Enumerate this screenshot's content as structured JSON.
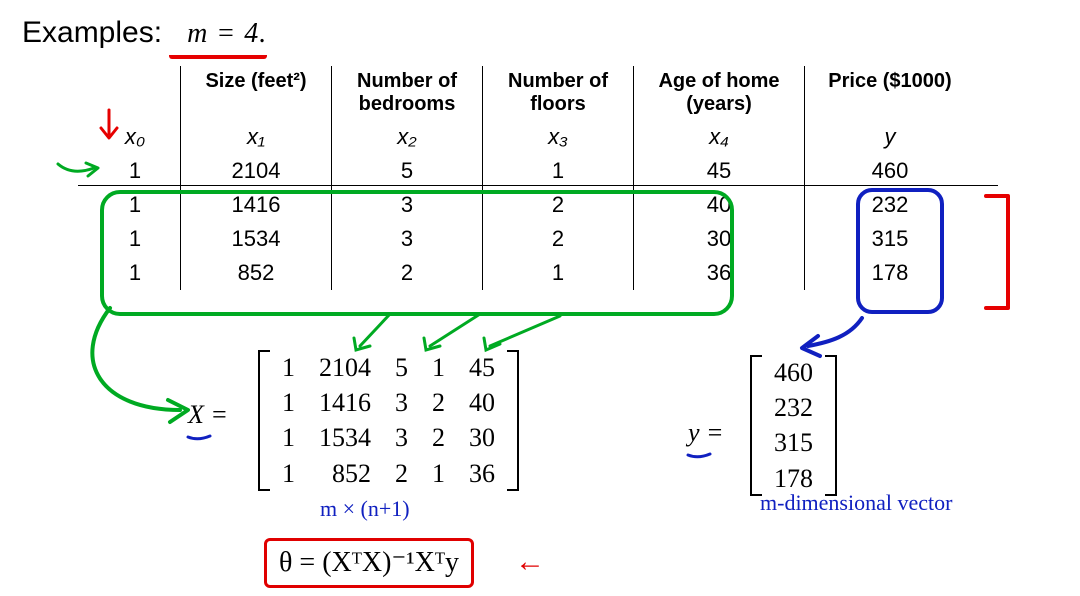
{
  "heading": {
    "label": "Examples:",
    "m_equation": "m = 4."
  },
  "table": {
    "headers": {
      "x0": "",
      "x1": "Size (feet²)",
      "x2": "Number of bedrooms",
      "x3": "Number of floors",
      "x4": "Age of home (years)",
      "y": "Price ($1000)"
    },
    "symbols": {
      "x0": "x₀",
      "x1": "x₁",
      "x2": "x₂",
      "x3": "x₃",
      "x4": "x₄",
      "y": "y"
    },
    "rows": [
      {
        "x0": "1",
        "x1": "2104",
        "x2": "5",
        "x3": "1",
        "x4": "45",
        "y": "460"
      },
      {
        "x0": "1",
        "x1": "1416",
        "x2": "3",
        "x3": "2",
        "x4": "40",
        "y": "232"
      },
      {
        "x0": "1",
        "x1": "1534",
        "x2": "3",
        "x3": "2",
        "x4": "30",
        "y": "315"
      },
      {
        "x0": "1",
        "x1": "852",
        "x2": "2",
        "x3": "1",
        "x4": "36",
        "y": "178"
      }
    ]
  },
  "matrix_X": {
    "label": "X =",
    "rows": [
      [
        "1",
        "2104",
        "5",
        "1",
        "45"
      ],
      [
        "1",
        "1416",
        "3",
        "2",
        "40"
      ],
      [
        "1",
        "1534",
        "3",
        "2",
        "30"
      ],
      [
        "1",
        "852",
        "2",
        "1",
        "36"
      ]
    ],
    "dim_annotation": "m × (n+1)"
  },
  "vector_y": {
    "label": "y =",
    "rows": [
      "460",
      "232",
      "315",
      "178"
    ],
    "dim_annotation": "m-dimensional vector"
  },
  "normal_equation": "θ = (XᵀX)⁻¹Xᵀy",
  "red_arrow_label": "←"
}
